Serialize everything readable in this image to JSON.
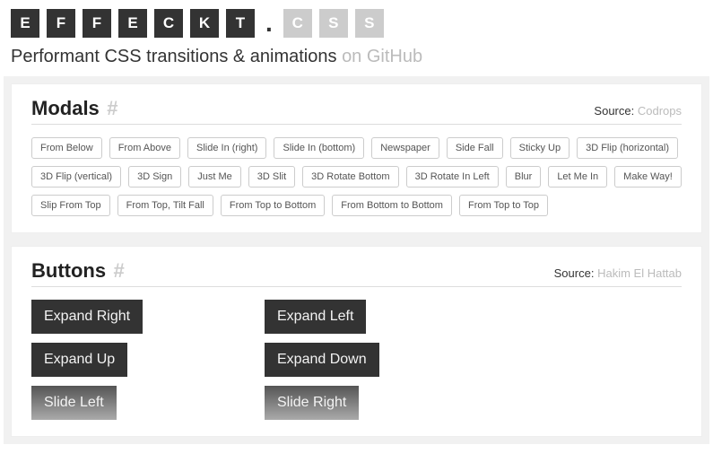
{
  "logo": {
    "dark": [
      "E",
      "F",
      "F",
      "E",
      "C",
      "K",
      "T"
    ],
    "dot": ".",
    "light": [
      "C",
      "S",
      "S"
    ]
  },
  "tagline": {
    "text": "Performant CSS transitions & animations",
    "link": "on GitHub"
  },
  "sections": {
    "modals": {
      "title": "Modals",
      "source_label": "Source:",
      "source_link": "Codrops",
      "items": [
        "From Below",
        "From Above",
        "Slide In (right)",
        "Slide In (bottom)",
        "Newspaper",
        "Side Fall",
        "Sticky Up",
        "3D Flip (horizontal)",
        "3D Flip (vertical)",
        "3D Sign",
        "Just Me",
        "3D Slit",
        "3D Rotate Bottom",
        "3D Rotate In Left",
        "Blur",
        "Let Me In",
        "Make Way!",
        "Slip From Top",
        "From Top, Tilt Fall",
        "From Top to Bottom",
        "From Bottom to Bottom",
        "From Top to Top"
      ]
    },
    "buttons": {
      "title": "Buttons",
      "source_label": "Source:",
      "source_link": "Hakim El Hattab",
      "items": [
        {
          "label": "Expand Right",
          "style": "solid"
        },
        {
          "label": "Expand Left",
          "style": "solid"
        },
        {
          "label": "Expand Up",
          "style": "solid"
        },
        {
          "label": "Expand Down",
          "style": "solid"
        },
        {
          "label": "Slide Left",
          "style": "faded"
        },
        {
          "label": "Slide Right",
          "style": "faded"
        }
      ]
    }
  }
}
